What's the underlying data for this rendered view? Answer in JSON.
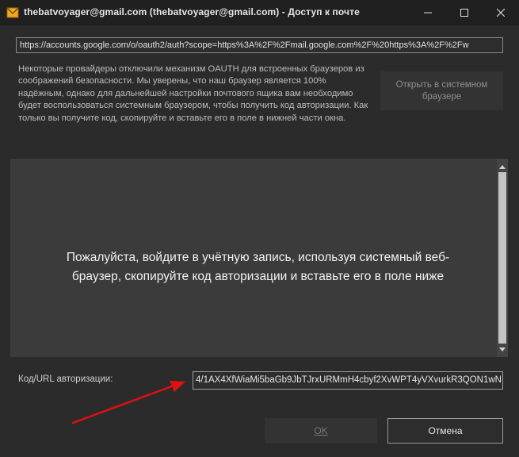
{
  "window": {
    "title": "thebatvoyager@gmail.com (thebatvoyager@gmail.com) - Доступ к почте",
    "app_icon": "the-bat-app-icon",
    "controls": {
      "minimize": "minimize-icon",
      "maximize": "maximize-icon",
      "close": "close-icon"
    }
  },
  "url_bar": {
    "value": "https://accounts.google.com/o/oauth2/auth?scope=https%3A%2F%2Fmail.google.com%2F%20https%3A%2F%2Fw"
  },
  "notice": {
    "text": "Некоторые провайдеры отключили механизм OAUTH для встроенных браузеров из соображений безопасности. Мы уверены, что наш браузер является 100% надёжным, однако для дальнейшей настройки почтового ящика вам необходимо будет воспользоваться системным браузером, чтобы получить код авторизации. Как только вы получите код, скопируйте и вставьте его в поле в нижней части окна."
  },
  "open_system_browser_button": {
    "label": "Открыть в системном браузере"
  },
  "browser": {
    "message": "Пожалуйста, войдите в учётную запись, используя системный веб-браузер, скопируйте код авторизации и вставьте его в поле ниже"
  },
  "auth_code": {
    "label": "Код/URL авторизации:",
    "value": "4/1AX4XfWiaMi5baGb9JbTJrxURMmH4cbyf2XvWPT4yVXvurkR3QON1wN"
  },
  "buttons": {
    "ok": "OK",
    "cancel": "Отмена"
  },
  "colors": {
    "window_bg": "#2b2b2b",
    "titlebar_bg": "#202020",
    "browser_bg": "#3b3b3b",
    "annotation_arrow": "#e01010"
  }
}
